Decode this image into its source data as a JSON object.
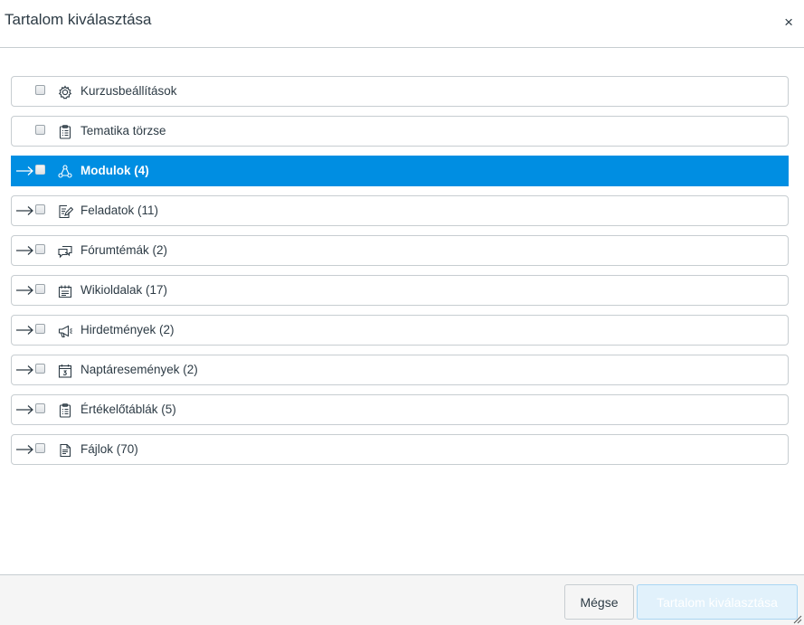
{
  "dialog": {
    "title": "Tartalom kiválasztása",
    "close_label": "×"
  },
  "items": [
    {
      "label": "Kurzusbeállítások",
      "icon": "gear-icon",
      "expandable": false,
      "selected": false
    },
    {
      "label": "Tematika törzse",
      "icon": "syllabus-icon",
      "expandable": false,
      "selected": false
    },
    {
      "label": "Modulok (4)",
      "icon": "modules-icon",
      "expandable": true,
      "selected": true
    },
    {
      "label": "Feladatok (11)",
      "icon": "assignment-icon",
      "expandable": true,
      "selected": false
    },
    {
      "label": "Fórumtémák (2)",
      "icon": "discussion-icon",
      "expandable": true,
      "selected": false
    },
    {
      "label": "Wikioldalak (17)",
      "icon": "document-icon",
      "expandable": true,
      "selected": false
    },
    {
      "label": "Hirdetmények (2)",
      "icon": "announcement-icon",
      "expandable": true,
      "selected": false
    },
    {
      "label": "Naptáresemények (2)",
      "icon": "calendar-icon",
      "expandable": true,
      "selected": false
    },
    {
      "label": "Értékelőtáblák (5)",
      "icon": "rubric-icon",
      "expandable": true,
      "selected": false
    },
    {
      "label": "Fájlok (70)",
      "icon": "file-icon",
      "expandable": true,
      "selected": false
    }
  ],
  "footer": {
    "cancel_label": "Mégse",
    "submit_label": "Tartalom kiválasztása"
  },
  "colors": {
    "selected_bg": "#008ee2",
    "border": "#c7cdd1",
    "text": "#2d3b45"
  }
}
